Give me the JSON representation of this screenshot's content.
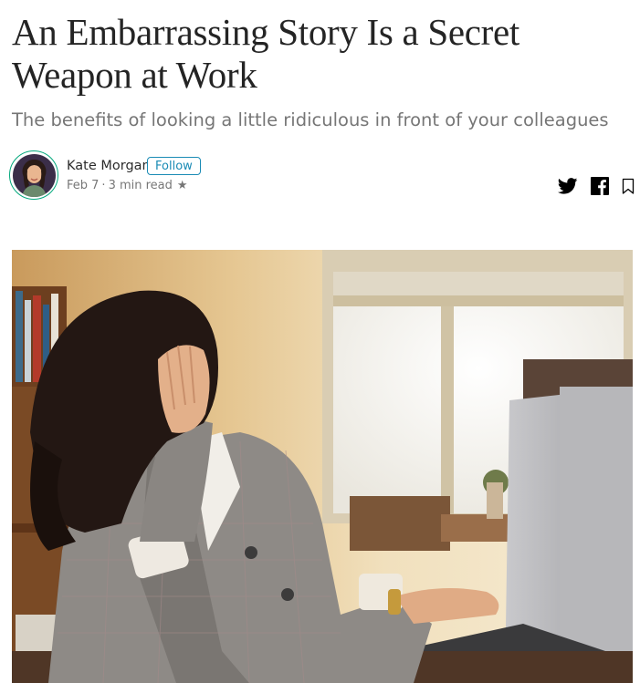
{
  "article": {
    "title": "An Embarrassing Story Is a Secret Weapon at Work",
    "subtitle": "The benefits of looking a little ridiculous in front of your colleagues"
  },
  "byline": {
    "author_name": "Kate Morgan",
    "follow_label": "Follow",
    "date": "Feb 7",
    "separator": "·",
    "read_time": "3 min read",
    "star_glyph": "★"
  },
  "share": {
    "icons": [
      "twitter-icon",
      "facebook-icon",
      "bookmark-icon"
    ]
  },
  "colors": {
    "accent_green": "#03a87c",
    "follow_blue": "#1a8bb5"
  }
}
